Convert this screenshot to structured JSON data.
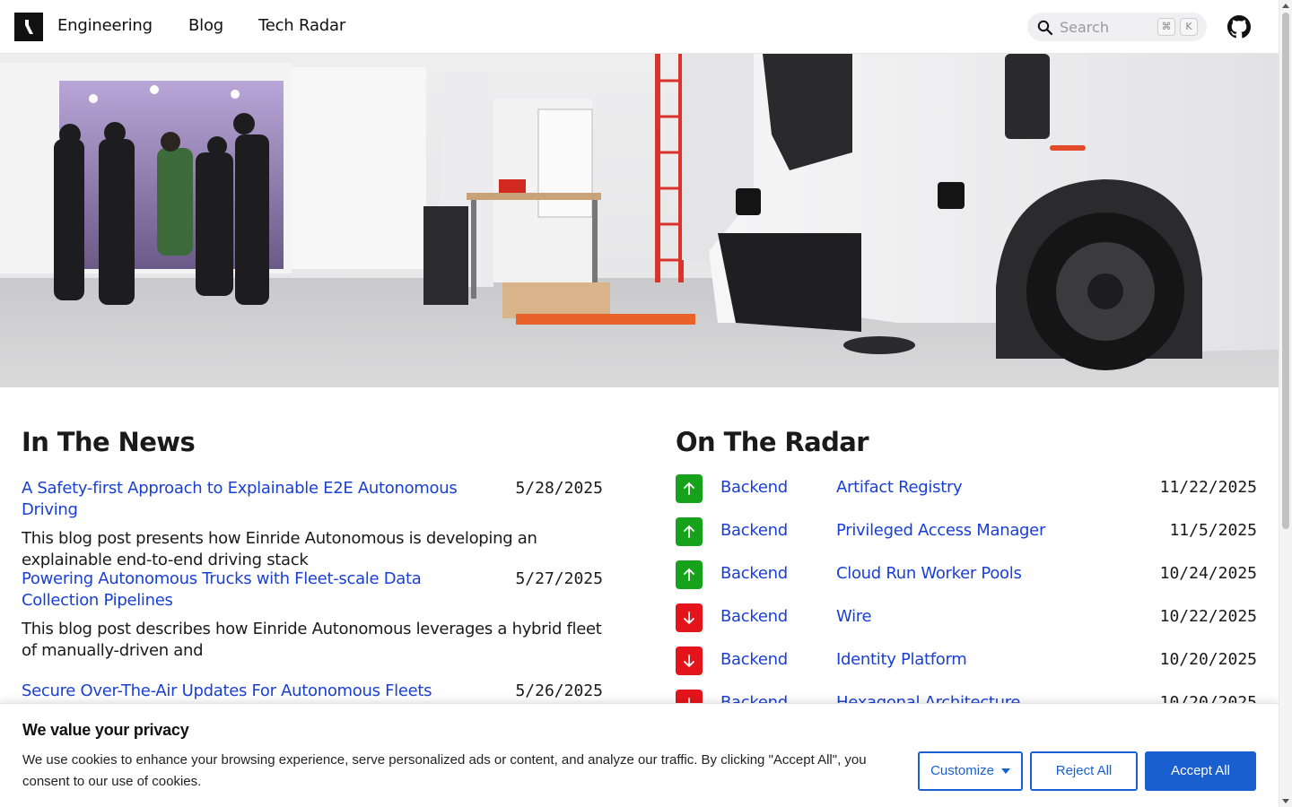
{
  "header": {
    "nav": [
      "Engineering",
      "Blog",
      "Tech Radar"
    ],
    "search_placeholder": "Search",
    "shortcut_keys": [
      "⌘",
      "K"
    ]
  },
  "news": {
    "title": "In The News",
    "items": [
      {
        "title": "A Safety-first Approach to Explainable E2E Autonomous Driving",
        "date": "5/28/2025",
        "description": "This blog post presents how Einride Autonomous is developing an explainable end-to-end driving stack"
      },
      {
        "title": "Powering Autonomous Trucks with Fleet-scale Data Collection Pipelines",
        "date": "5/27/2025",
        "description": "This blog post describes how Einride Autonomous leverages a hybrid fleet of manually-driven and"
      },
      {
        "title": "Secure Over-The-Air Updates For Autonomous Fleets",
        "date": "5/26/2025",
        "description": ""
      }
    ]
  },
  "radar": {
    "title": "On The Radar",
    "items": [
      {
        "direction": "up",
        "category": "Backend",
        "name": "Artifact Registry",
        "date": "11/22/2025"
      },
      {
        "direction": "up",
        "category": "Backend",
        "name": "Privileged Access Manager",
        "date": "11/5/2025"
      },
      {
        "direction": "up",
        "category": "Backend",
        "name": "Cloud Run Worker Pools",
        "date": "10/24/2025"
      },
      {
        "direction": "down",
        "category": "Backend",
        "name": "Wire",
        "date": "10/22/2025"
      },
      {
        "direction": "down",
        "category": "Backend",
        "name": "Identity Platform",
        "date": "10/20/2025"
      },
      {
        "direction": "down",
        "category": "Backend",
        "name": "Hexagonal Architecture",
        "date": "10/20/2025"
      }
    ]
  },
  "cookie": {
    "title": "We value your privacy",
    "text": "We use cookies to enhance your browsing experience, serve personalized ads or content, and analyze our traffic. By clicking \"Accept All\", you consent to our use of cookies.",
    "customize": "Customize",
    "reject": "Reject All",
    "accept": "Accept All"
  },
  "colors": {
    "link": "#1a3fd4",
    "radar_up": "#17a21c",
    "radar_down": "#e3151b",
    "cookie_button": "#1a5fd0"
  }
}
